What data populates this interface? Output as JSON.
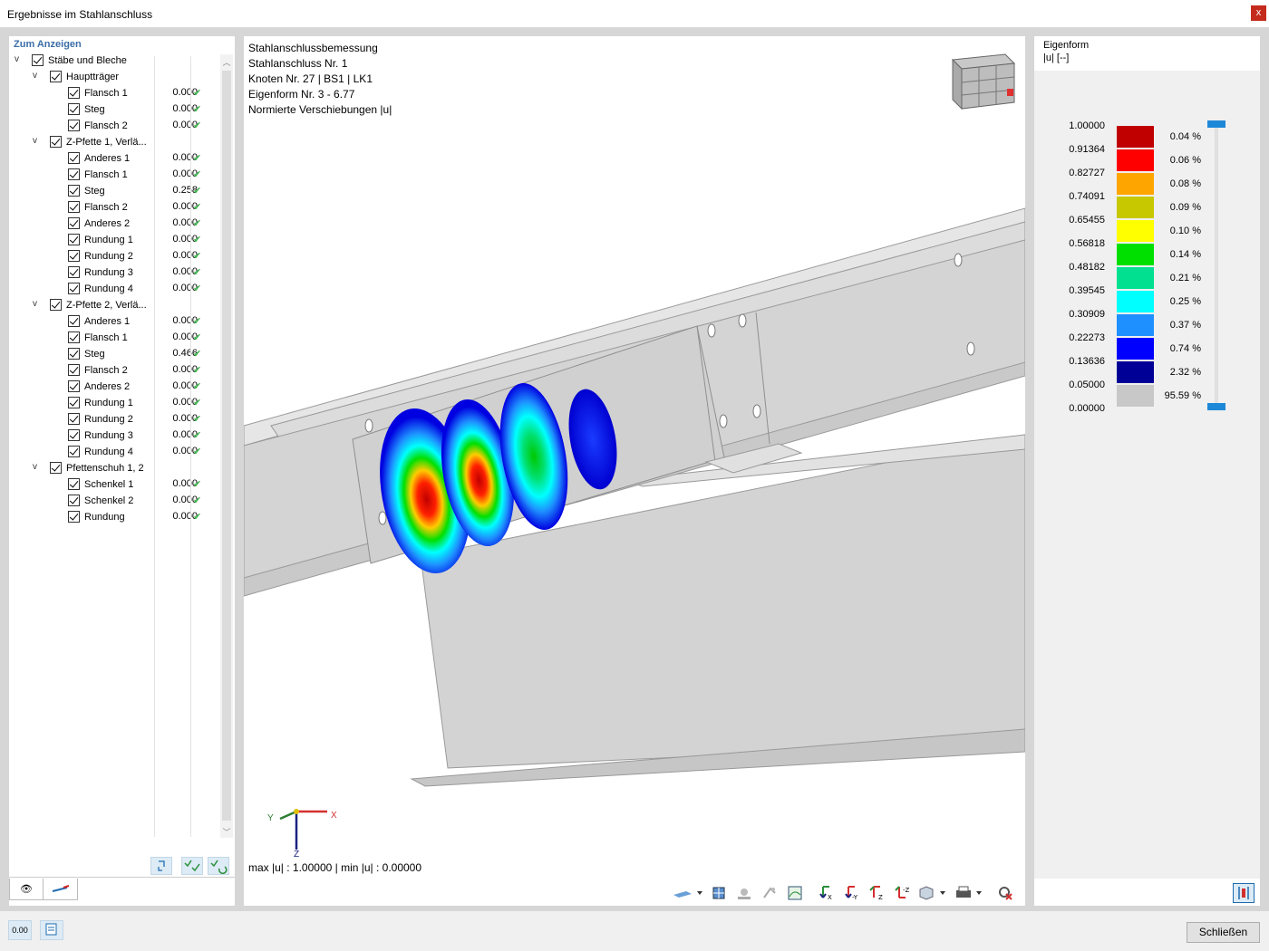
{
  "window": {
    "title": "Ergebnisse im Stahlanschluss",
    "close_glyph": "x"
  },
  "left_panel": {
    "header": "Zum Anzeigen",
    "tree": [
      {
        "level": 0,
        "expander": "v",
        "label": "Stäbe und Bleche"
      },
      {
        "level": 1,
        "expander": "v",
        "label": "Hauptträger"
      },
      {
        "level": 2,
        "label": "Flansch 1",
        "value": "0.000",
        "ok": "✔"
      },
      {
        "level": 2,
        "label": "Steg",
        "value": "0.000",
        "ok": "✔"
      },
      {
        "level": 2,
        "label": "Flansch 2",
        "value": "0.000",
        "ok": "✔"
      },
      {
        "level": 1,
        "expander": "v",
        "label": "Z-Pfette 1, Verlä..."
      },
      {
        "level": 2,
        "label": "Anderes 1",
        "value": "0.000",
        "ok": "✔"
      },
      {
        "level": 2,
        "label": "Flansch 1",
        "value": "0.000",
        "ok": "✔"
      },
      {
        "level": 2,
        "label": "Steg",
        "value": "0.258",
        "ok": "✔"
      },
      {
        "level": 2,
        "label": "Flansch 2",
        "value": "0.000",
        "ok": "✔"
      },
      {
        "level": 2,
        "label": "Anderes 2",
        "value": "0.000",
        "ok": "✔"
      },
      {
        "level": 2,
        "label": "Rundung 1",
        "value": "0.000",
        "ok": "✔"
      },
      {
        "level": 2,
        "label": "Rundung 2",
        "value": "0.000",
        "ok": "✔"
      },
      {
        "level": 2,
        "label": "Rundung 3",
        "value": "0.000",
        "ok": "✔"
      },
      {
        "level": 2,
        "label": "Rundung 4",
        "value": "0.000",
        "ok": "✔"
      },
      {
        "level": 1,
        "expander": "v",
        "label": "Z-Pfette 2, Verlä..."
      },
      {
        "level": 2,
        "label": "Anderes 1",
        "value": "0.000",
        "ok": "✔"
      },
      {
        "level": 2,
        "label": "Flansch 1",
        "value": "0.000",
        "ok": "✔"
      },
      {
        "level": 2,
        "label": "Steg",
        "value": "0.466",
        "ok": "✔"
      },
      {
        "level": 2,
        "label": "Flansch 2",
        "value": "0.000",
        "ok": "✔"
      },
      {
        "level": 2,
        "label": "Anderes 2",
        "value": "0.000",
        "ok": "✔"
      },
      {
        "level": 2,
        "label": "Rundung 1",
        "value": "0.000",
        "ok": "✔"
      },
      {
        "level": 2,
        "label": "Rundung 2",
        "value": "0.000",
        "ok": "✔"
      },
      {
        "level": 2,
        "label": "Rundung 3",
        "value": "0.000",
        "ok": "✔"
      },
      {
        "level": 2,
        "label": "Rundung 4",
        "value": "0.000",
        "ok": "✔"
      },
      {
        "level": 1,
        "expander": "v",
        "label": "Pfettenschuh 1, 2"
      },
      {
        "level": 2,
        "label": "Schenkel 1",
        "value": "0.000",
        "ok": "✔"
      },
      {
        "level": 2,
        "label": "Schenkel 2",
        "value": "0.000",
        "ok": "✔"
      },
      {
        "level": 2,
        "label": "Rundung",
        "value": "0.000",
        "ok": "✔"
      }
    ],
    "tabs": [
      {
        "icon": "eye-icon",
        "glyph": "👁"
      },
      {
        "icon": "member-icon",
        "glyph": ""
      }
    ]
  },
  "viewport": {
    "info_lines": [
      "Stahlanschlussbemessung",
      "Stahlanschluss Nr. 1",
      "Knoten Nr. 27 | BS1 | LK1",
      "Eigenform Nr. 3 - 6.77",
      "Normierte Verschiebungen |u|"
    ],
    "axes": {
      "x": "X",
      "y": "Y",
      "z": "Z"
    },
    "maxmin": "max |u| : 1.00000 | min |u| : 0.00000"
  },
  "legend": {
    "title": "Eigenform",
    "unit": "|u| [--]",
    "values": [
      "1.00000",
      "0.91364",
      "0.82727",
      "0.74091",
      "0.65455",
      "0.56818",
      "0.48182",
      "0.39545",
      "0.30909",
      "0.22273",
      "0.13636",
      "0.05000",
      "0.00000"
    ],
    "bands": [
      {
        "color": "#c00000",
        "percent": "0.04 %"
      },
      {
        "color": "#ff0000",
        "percent": "0.06 %"
      },
      {
        "color": "#ffa500",
        "percent": "0.08 %"
      },
      {
        "color": "#c8c800",
        "percent": "0.09 %"
      },
      {
        "color": "#ffff00",
        "percent": "0.10 %"
      },
      {
        "color": "#00e000",
        "percent": "0.14 %"
      },
      {
        "color": "#00e090",
        "percent": "0.21 %"
      },
      {
        "color": "#00ffff",
        "percent": "0.25 %"
      },
      {
        "color": "#1e90ff",
        "percent": "0.37 %"
      },
      {
        "color": "#0000ff",
        "percent": "0.74 %"
      },
      {
        "color": "#000096",
        "percent": "2.32 %"
      },
      {
        "color": "#c8c8c8",
        "percent": "95.59 %"
      }
    ]
  },
  "footer": {
    "close_label": "Schließen",
    "units_button_glyph": "0.00"
  }
}
